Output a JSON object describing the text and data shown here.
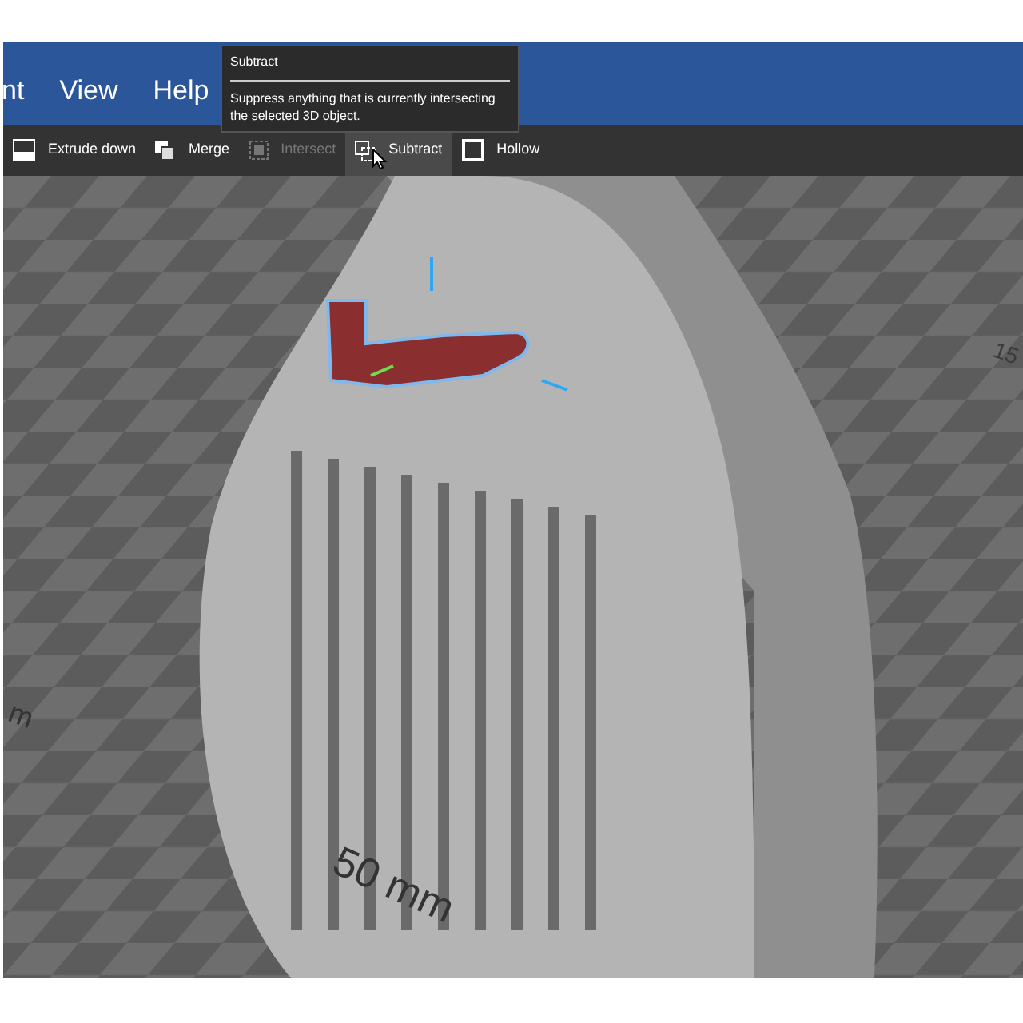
{
  "menu": [
    {
      "label": "nt"
    },
    {
      "label": "View"
    },
    {
      "label": "Help"
    }
  ],
  "toolbar": [
    {
      "label": "Extrude down",
      "kind": "extrude",
      "disabled": false,
      "hovered": false
    },
    {
      "label": "Merge",
      "kind": "merge",
      "disabled": false,
      "hovered": false
    },
    {
      "label": "Intersect",
      "kind": "intersect",
      "disabled": true,
      "hovered": false
    },
    {
      "label": "Subtract",
      "kind": "subtract",
      "disabled": false,
      "hovered": true
    },
    {
      "label": "Hollow",
      "kind": "hollow",
      "disabled": false,
      "hovered": false
    }
  ],
  "tooltip": {
    "title": "Subtract",
    "text": "Suppress anything that is currently intersecting the selected 3D object."
  },
  "viewport": {
    "scale_labels": [
      {
        "text": "50 mm",
        "kind": "center"
      },
      {
        "text": "m",
        "kind": "left"
      },
      {
        "text": "15",
        "kind": "right"
      }
    ]
  }
}
